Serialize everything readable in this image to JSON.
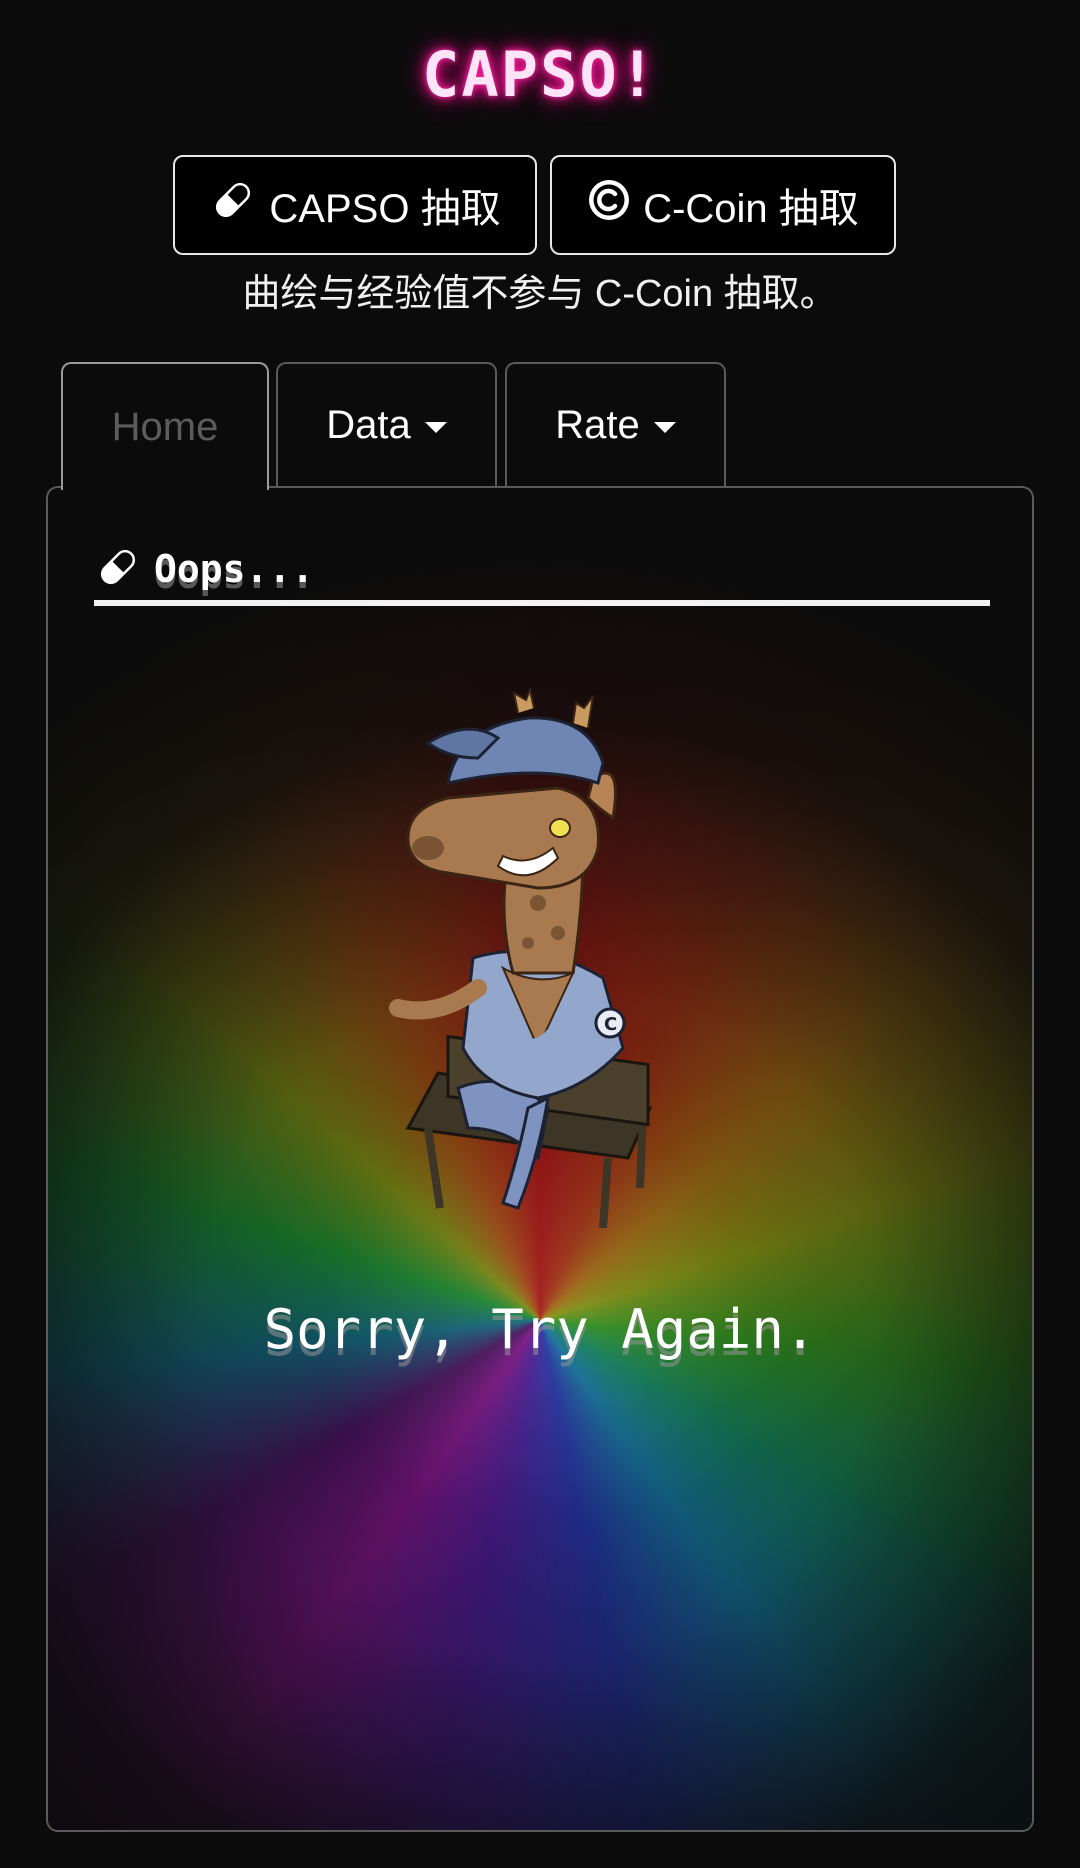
{
  "app": {
    "title": "CAPSO!"
  },
  "draw_buttons": {
    "capso": {
      "label": "CAPSO 抽取",
      "icon": "pill-icon"
    },
    "ccoin": {
      "label": "C-Coin 抽取",
      "icon": "copyright-coin-icon"
    }
  },
  "notice": "曲绘与经验值不参与 C-Coin 抽取。",
  "tabs": [
    {
      "label": "Home",
      "active": true
    },
    {
      "label": "Data",
      "dropdown": true
    },
    {
      "label": "Rate",
      "dropdown": true
    }
  ],
  "panel": {
    "header_icon": "pill-icon",
    "header": "Oops...",
    "mascot": "giraffe-mascot-illustration",
    "message": "Sorry, Try Again."
  },
  "colors": {
    "background": "#0b0b0b",
    "title_glow": "#ff1493",
    "border": "#5a5a5a",
    "text": "#ffffff"
  }
}
